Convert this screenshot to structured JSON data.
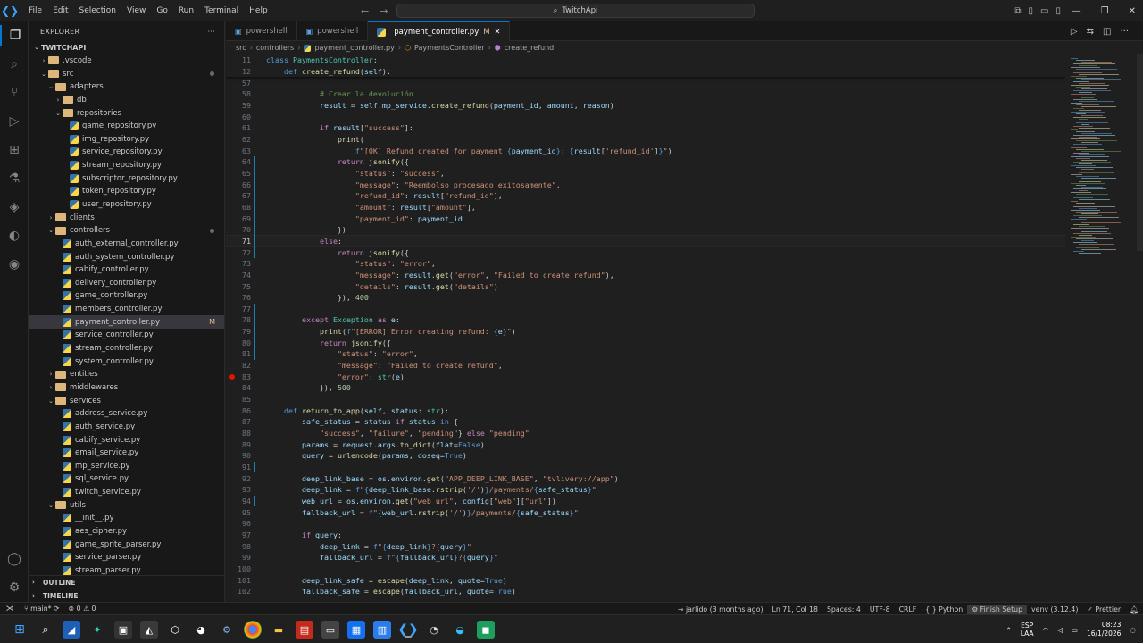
{
  "menu": [
    "File",
    "Edit",
    "Selection",
    "View",
    "Go",
    "Run",
    "Terminal",
    "Help"
  ],
  "search": {
    "text": "TwitchApi"
  },
  "explorer": {
    "title": "EXPLORER",
    "root": "TWITCHAPI",
    "items": [
      {
        "label": ".vscode",
        "depth": 1,
        "type": "folder",
        "open": false
      },
      {
        "label": "src",
        "depth": 1,
        "type": "folder",
        "open": true,
        "dot": true
      },
      {
        "label": "adapters",
        "depth": 2,
        "type": "folder",
        "open": true
      },
      {
        "label": "db",
        "depth": 3,
        "type": "folder",
        "open": false
      },
      {
        "label": "repositories",
        "depth": 3,
        "type": "folder",
        "open": true
      },
      {
        "label": "game_repository.py",
        "depth": 4,
        "type": "py"
      },
      {
        "label": "img_repository.py",
        "depth": 4,
        "type": "py"
      },
      {
        "label": "service_repository.py",
        "depth": 4,
        "type": "py"
      },
      {
        "label": "stream_repository.py",
        "depth": 4,
        "type": "py"
      },
      {
        "label": "subscriptor_repository.py",
        "depth": 4,
        "type": "py"
      },
      {
        "label": "token_repository.py",
        "depth": 4,
        "type": "py"
      },
      {
        "label": "user_repository.py",
        "depth": 4,
        "type": "py"
      },
      {
        "label": "clients",
        "depth": 2,
        "type": "folder",
        "open": false
      },
      {
        "label": "controllers",
        "depth": 2,
        "type": "folder",
        "open": true,
        "dot": true
      },
      {
        "label": "auth_external_controller.py",
        "depth": 3,
        "type": "py"
      },
      {
        "label": "auth_system_controller.py",
        "depth": 3,
        "type": "py"
      },
      {
        "label": "cabify_controller.py",
        "depth": 3,
        "type": "py"
      },
      {
        "label": "delivery_controller.py",
        "depth": 3,
        "type": "py"
      },
      {
        "label": "game_controller.py",
        "depth": 3,
        "type": "py"
      },
      {
        "label": "members_controller.py",
        "depth": 3,
        "type": "py"
      },
      {
        "label": "payment_controller.py",
        "depth": 3,
        "type": "py",
        "selected": true,
        "badge": "M"
      },
      {
        "label": "service_controller.py",
        "depth": 3,
        "type": "py"
      },
      {
        "label": "stream_controller.py",
        "depth": 3,
        "type": "py"
      },
      {
        "label": "system_controller.py",
        "depth": 3,
        "type": "py"
      },
      {
        "label": "entities",
        "depth": 2,
        "type": "folder",
        "open": false
      },
      {
        "label": "middlewares",
        "depth": 2,
        "type": "folder",
        "open": false
      },
      {
        "label": "services",
        "depth": 2,
        "type": "folder",
        "open": true
      },
      {
        "label": "address_service.py",
        "depth": 3,
        "type": "py"
      },
      {
        "label": "auth_service.py",
        "depth": 3,
        "type": "py"
      },
      {
        "label": "cabify_service.py",
        "depth": 3,
        "type": "py"
      },
      {
        "label": "email_service.py",
        "depth": 3,
        "type": "py"
      },
      {
        "label": "mp_service.py",
        "depth": 3,
        "type": "py"
      },
      {
        "label": "sql_service.py",
        "depth": 3,
        "type": "py"
      },
      {
        "label": "twitch_service.py",
        "depth": 3,
        "type": "py"
      },
      {
        "label": "utils",
        "depth": 2,
        "type": "folder",
        "open": true
      },
      {
        "label": "__init__.py",
        "depth": 3,
        "type": "py"
      },
      {
        "label": "aes_cipher.py",
        "depth": 3,
        "type": "py"
      },
      {
        "label": "game_sprite_parser.py",
        "depth": 3,
        "type": "py"
      },
      {
        "label": "service_parser.py",
        "depth": 3,
        "type": "py"
      },
      {
        "label": "stream_parser.py",
        "depth": 3,
        "type": "py"
      }
    ],
    "outline": "OUTLINE",
    "timeline": "TIMELINE"
  },
  "tabs": [
    {
      "label": "powershell",
      "active": false
    },
    {
      "label": "powershell",
      "active": false
    },
    {
      "label": "payment_controller.py",
      "active": true,
      "modified": "M"
    }
  ],
  "breadcrumb": [
    "src",
    "controllers",
    "payment_controller.py",
    "PaymentsController",
    "create_refund"
  ],
  "editor": {
    "sticky": [
      {
        "n": 11,
        "html": "<span class='k'>class</span> <span class='t'>PaymentsController</span>:"
      },
      {
        "n": 12,
        "html": "    <span class='k'>def</span> <span class='f'>create_refund</span>(<span class='v'>self</span>):"
      }
    ],
    "lines": [
      {
        "n": 57,
        "html": ""
      },
      {
        "n": 58,
        "html": "            <span class='c'># Crear la devolución</span>"
      },
      {
        "n": 59,
        "html": "            <span class='v'>result</span> = <span class='v'>self</span>.<span class='v'>mp_service</span>.<span class='f'>create_refund</span>(<span class='v'>payment_id</span>, <span class='v'>amount</span>, <span class='v'>reason</span>)"
      },
      {
        "n": 60,
        "html": ""
      },
      {
        "n": 61,
        "html": "            <span class='kc'>if</span> <span class='v'>result</span>[<span class='s'>\"success\"</span>]:"
      },
      {
        "n": 62,
        "html": "                <span class='f'>print</span>("
      },
      {
        "n": 63,
        "html": "                    <span class='k'>f</span><span class='s'>\"[OK] Refund created for payment </span><span class='k'>{</span><span class='v'>payment_id</span><span class='k'>}</span><span class='s'>: </span><span class='k'>{</span><span class='v'>result</span>[<span class='s'>'refund_id'</span>]<span class='k'>}</span><span class='s'>\"</span>)"
      },
      {
        "n": 64,
        "html": "                <span class='kc'>return</span> <span class='f'>jsonify</span>({"
      },
      {
        "n": 65,
        "html": "                    <span class='s'>\"status\"</span>: <span class='s'>\"success\"</span>,"
      },
      {
        "n": 66,
        "html": "                    <span class='s'>\"message\"</span>: <span class='s'>\"Reembolso procesado exitosamente\"</span>,"
      },
      {
        "n": 67,
        "html": "                    <span class='s'>\"refund_id\"</span>: <span class='v'>result</span>[<span class='s'>\"refund_id\"</span>],"
      },
      {
        "n": 68,
        "html": "                    <span class='s'>\"amount\"</span>: <span class='v'>result</span>[<span class='s'>\"amount\"</span>],"
      },
      {
        "n": 69,
        "html": "                    <span class='s'>\"payment_id\"</span>: <span class='v'>payment_id</span>"
      },
      {
        "n": 70,
        "html": "                })"
      },
      {
        "n": 71,
        "html": "            <span class='kc'>else</span>:",
        "cur": true
      },
      {
        "n": 72,
        "html": "                <span class='kc'>return</span> <span class='f'>jsonify</span>({"
      },
      {
        "n": 73,
        "html": "                    <span class='s'>\"status\"</span>: <span class='s'>\"error\"</span>,"
      },
      {
        "n": 74,
        "html": "                    <span class='s'>\"message\"</span>: <span class='v'>result</span>.<span class='f'>get</span>(<span class='s'>\"error\"</span>, <span class='s'>\"Failed to create refund\"</span>),"
      },
      {
        "n": 75,
        "html": "                    <span class='s'>\"details\"</span>: <span class='v'>result</span>.<span class='f'>get</span>(<span class='s'>\"details\"</span>)"
      },
      {
        "n": 76,
        "html": "                }), <span class='n'>400</span>"
      },
      {
        "n": 77,
        "html": ""
      },
      {
        "n": 78,
        "html": "        <span class='kc'>except</span> <span class='t'>Exception</span> <span class='kc'>as</span> <span class='v'>e</span>:"
      },
      {
        "n": 79,
        "html": "            <span class='f'>print</span>(<span class='k'>f</span><span class='s'>\"[ERROR] Error creating refund: </span><span class='k'>{</span><span class='v'>e</span><span class='k'>}</span><span class='s'>\"</span>)"
      },
      {
        "n": 80,
        "html": "            <span class='kc'>return</span> <span class='f'>jsonify</span>({"
      },
      {
        "n": 81,
        "html": "                <span class='s'>\"status\"</span>: <span class='s'>\"error\"</span>,"
      },
      {
        "n": 82,
        "html": "                <span class='s'>\"message\"</span>: <span class='s'>\"Failed to create refund\"</span>,"
      },
      {
        "n": 83,
        "html": "                <span class='s'>\"error\"</span>: <span class='t'>str</span>(<span class='v'>e</span>)",
        "bp": true
      },
      {
        "n": 84,
        "html": "            }), <span class='n'>500</span>"
      },
      {
        "n": 85,
        "html": ""
      },
      {
        "n": 86,
        "html": "    <span class='k'>def</span> <span class='f'>return_to_app</span>(<span class='v'>self</span>, <span class='v'>status</span>: <span class='t'>str</span>):"
      },
      {
        "n": 87,
        "html": "        <span class='v'>safe_status</span> = <span class='v'>status</span> <span class='kc'>if</span> <span class='v'>status</span> <span class='k'>in</span> {"
      },
      {
        "n": 88,
        "html": "            <span class='s'>\"success\"</span>, <span class='s'>\"failure\"</span>, <span class='s'>\"pending\"</span>} <span class='kc'>else</span> <span class='s'>\"pending\"</span>"
      },
      {
        "n": 89,
        "html": "        <span class='v'>params</span> = <span class='v'>request</span>.<span class='v'>args</span>.<span class='f'>to_dict</span>(<span class='v'>flat</span>=<span class='k'>False</span>)"
      },
      {
        "n": 90,
        "html": "        <span class='v'>query</span> = <span class='f'>urlencode</span>(<span class='v'>params</span>, <span class='v'>doseq</span>=<span class='k'>True</span>)"
      },
      {
        "n": 91,
        "html": ""
      },
      {
        "n": 92,
        "html": "        <span class='v'>deep_link_base</span> = <span class='v'>os</span>.<span class='v'>environ</span>.<span class='f'>get</span>(<span class='s'>\"APP_DEEP_LINK_BASE\"</span>, <span class='s'>\"tvlivery://app\"</span>)"
      },
      {
        "n": 93,
        "html": "        <span class='v'>deep_link</span> = <span class='k'>f</span><span class='s'>\"</span><span class='k'>{</span><span class='v'>deep_link_base</span>.<span class='f'>rstrip</span>(<span class='s'>'/'</span>)<span class='k'>}</span><span class='s'>/payments/</span><span class='k'>{</span><span class='v'>safe_status</span><span class='k'>}</span><span class='s'>\"</span>"
      },
      {
        "n": 94,
        "html": "        <span class='v'>web_url</span> = <span class='v'>os</span>.<span class='v'>environ</span>.<span class='f'>get</span>(<span class='s'>\"web_url\"</span>, <span class='v'>config</span>[<span class='s'>\"web\"</span>][<span class='s'>\"url\"</span>])"
      },
      {
        "n": 95,
        "html": "        <span class='v'>fallback_url</span> = <span class='k'>f</span><span class='s'>\"</span><span class='k'>{</span><span class='v'>web_url</span>.<span class='f'>rstrip</span>(<span class='s'>'/'</span>)<span class='k'>}</span><span class='s'>/payments/</span><span class='k'>{</span><span class='v'>safe_status</span><span class='k'>}</span><span class='s'>\"</span>"
      },
      {
        "n": 96,
        "html": ""
      },
      {
        "n": 97,
        "html": "        <span class='kc'>if</span> <span class='v'>query</span>:"
      },
      {
        "n": 98,
        "html": "            <span class='v'>deep_link</span> = <span class='k'>f</span><span class='s'>\"</span><span class='k'>{</span><span class='v'>deep_link</span><span class='k'>}</span><span class='s'>?</span><span class='k'>{</span><span class='v'>query</span><span class='k'>}</span><span class='s'>\"</span>"
      },
      {
        "n": 99,
        "html": "            <span class='v'>fallback_url</span> = <span class='k'>f</span><span class='s'>\"</span><span class='k'>{</span><span class='v'>fallback_url</span><span class='k'>}</span><span class='s'>?</span><span class='k'>{</span><span class='v'>query</span><span class='k'>}</span><span class='s'>\"</span>"
      },
      {
        "n": 100,
        "html": ""
      },
      {
        "n": 101,
        "html": "        <span class='v'>deep_link_safe</span> = <span class='f'>escape</span>(<span class='v'>deep_link</span>, <span class='v'>quote</span>=<span class='k'>True</span>)"
      },
      {
        "n": 102,
        "html": "        <span class='v'>fallback_safe</span> = <span class='f'>escape</span>(<span class='v'>fallback_url</span>, <span class='v'>quote</span>=<span class='k'>True</span>)"
      }
    ]
  },
  "status": {
    "branch": "main*",
    "problems": "0",
    "warnings": "0",
    "blame": "jarlido (3 months ago)",
    "position": "Ln 71, Col 18",
    "spaces": "Spaces: 4",
    "encoding": "UTF-8",
    "eol": "CRLF",
    "language": "Python",
    "setup": "Finish Setup",
    "venv": "venv (3.12.4)",
    "prettier": "Prettier"
  },
  "tray": {
    "lang1": "ESP",
    "lang2": "LAA",
    "time": "08:23",
    "date": "16/1/2026"
  }
}
